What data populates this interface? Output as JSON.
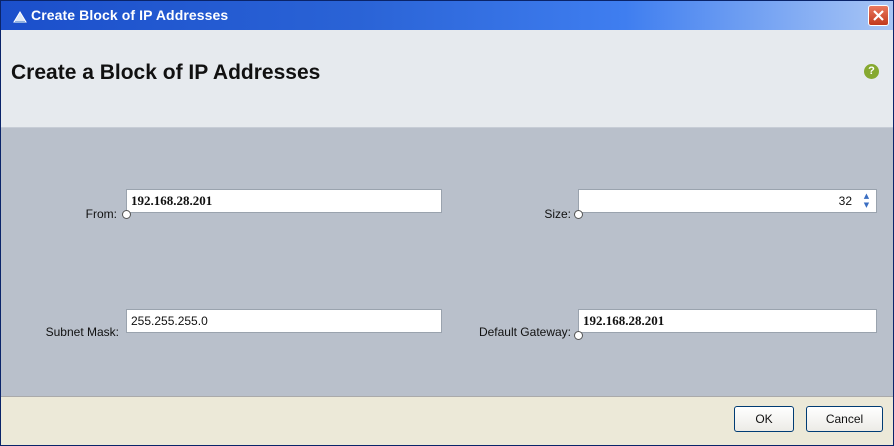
{
  "window": {
    "title": "Create Block of IP Addresses",
    "close_glyph": "✕",
    "icon": "app-icon"
  },
  "header": {
    "title": "Create a Block of IP Addresses",
    "help_glyph": "?",
    "help_icon": "help-icon"
  },
  "form": {
    "from": {
      "label": "From:",
      "value": "192.168.28.201"
    },
    "size": {
      "label": "Size:",
      "value": "32"
    },
    "subnet_mask": {
      "label": "Subnet Mask:",
      "value": "255.255.255.0"
    },
    "default_gateway": {
      "label": "Default Gateway:",
      "value": "192.168.28.201"
    }
  },
  "footer": {
    "ok_label": "OK",
    "cancel_label": "Cancel"
  },
  "colors": {
    "titlebar": "#2a63d6",
    "header_bg": "#e6eaee",
    "form_bg": "#b9c0cb",
    "footer_bg": "#ece9d8",
    "close_button": "#c2391d",
    "help_icon": "#86a930"
  }
}
